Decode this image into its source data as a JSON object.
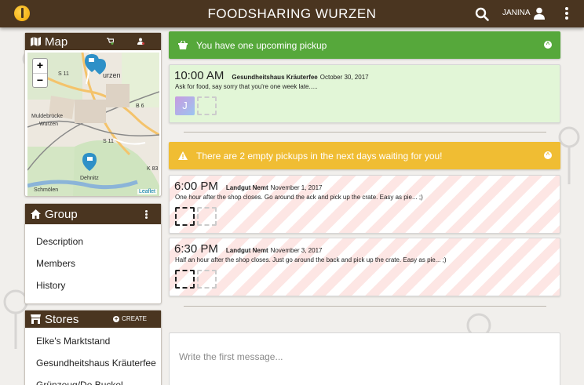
{
  "app": {
    "title": "FOODSHARING WURZEN",
    "user": "JANINA"
  },
  "map": {
    "title": "Map",
    "labels": [
      "Muldebrücke",
      "Wurzen",
      "S 11",
      "S 11",
      "B 6",
      "K 83",
      "Dehnitz",
      "Schmölen",
      "urzen"
    ],
    "zoom_in": "+",
    "zoom_out": "−",
    "attribution": "Leaflet"
  },
  "group": {
    "title": "Group",
    "items": [
      "Description",
      "Members",
      "History"
    ]
  },
  "stores": {
    "title": "Stores",
    "create_label": "CREATE",
    "items": [
      "Elke's Marktstand",
      "Gesundheitshaus Kräuterfee",
      "Grünzeug/De Buckel"
    ]
  },
  "upcoming": {
    "banner": "You have one upcoming pickup",
    "pickup": {
      "time": "10:00 AM",
      "store": "Gesundheitshaus Kräuterfee",
      "date": "October 30, 2017",
      "description": "Ask for food, say sorry that you're one week late.....",
      "avatar_letter": "J"
    }
  },
  "empty": {
    "banner": "There are 2 empty pickups in the next days waiting for you!",
    "pickups": [
      {
        "time": "6:00 PM",
        "store": "Landgut Nemt",
        "date": "November 1, 2017",
        "description": "One hour after the shop closes. Go around the ack and pick up the crate. Easy as pie... ;)"
      },
      {
        "time": "6:30 PM",
        "store": "Landgut Nemt",
        "date": "November 3, 2017",
        "description": "Half an hour after the shop closes. Just go around the back and pick up the crate. Easy as pie... ;)"
      }
    ]
  },
  "message": {
    "placeholder": "Write the first message..."
  },
  "colors": {
    "topbar": "#4a3520",
    "success": "#56a83b",
    "warning": "#f0bd33",
    "empty_stripe": "#fde6e4",
    "pickup_green": "#e2f6d7"
  },
  "icons": [
    "logo-icon",
    "search-icon",
    "user-icon",
    "kebab-icon",
    "map-icon",
    "home-icon",
    "store-icon",
    "basket-icon",
    "warning-icon",
    "chevron-up-icon"
  ]
}
